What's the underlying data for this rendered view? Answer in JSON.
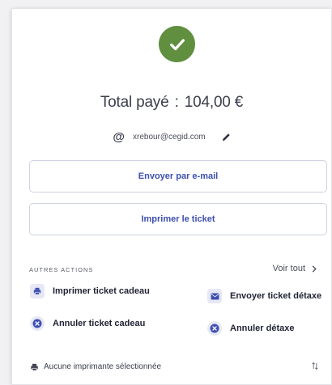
{
  "payment": {
    "total_label": "Total payé",
    "separator": ":",
    "amount": "104,00 €",
    "email": "xrebour@cegid.com"
  },
  "buttons": {
    "send_email": "Envoyer par e-mail",
    "print_ticket": "Imprimer le ticket"
  },
  "other_actions": {
    "title": "AUTRES ACTIONS",
    "see_all": "Voir tout",
    "items": [
      {
        "label": "Imprimer ticket cadeau",
        "icon": "printer-icon"
      },
      {
        "label": "Envoyer ticket détaxe",
        "icon": "mail-icon"
      },
      {
        "label": "Annuler ticket cadeau",
        "icon": "cancel-icon"
      },
      {
        "label": "Annuler détaxe",
        "icon": "cancel-icon"
      }
    ]
  },
  "printer": {
    "status": "Aucune imprimante sélectionnée"
  },
  "colors": {
    "success": "#5f8f3f",
    "accent": "#3d4fb0",
    "icon_bg": "#e6e8f6"
  }
}
